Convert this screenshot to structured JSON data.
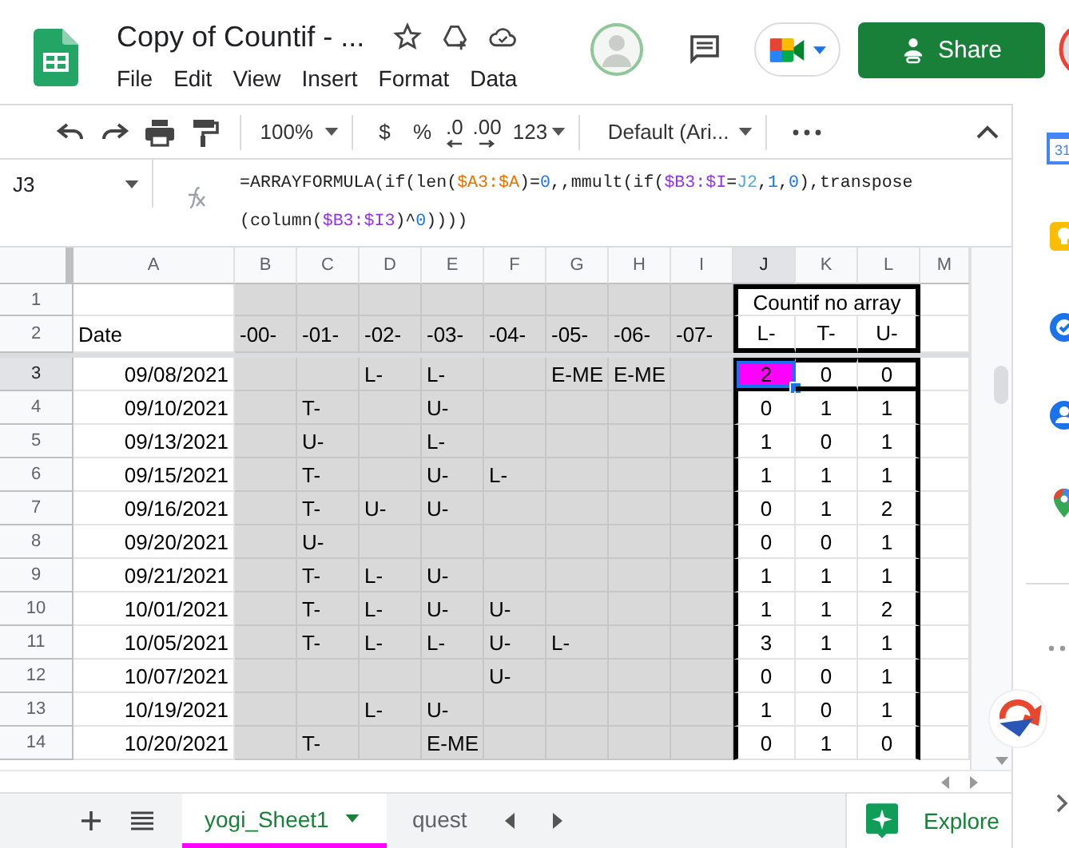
{
  "document": {
    "title": "Copy of Countif - ...",
    "menus": [
      "File",
      "Edit",
      "View",
      "Insert",
      "Format",
      "Data"
    ]
  },
  "header_actions": {
    "share": "Share"
  },
  "toolbar": {
    "zoom": "100%",
    "currency": "$",
    "percent": "%",
    "decrease_decimals": ".0",
    "increase_decimals": ".00",
    "number_format": "123",
    "font": "Default (Ari..."
  },
  "formula_bar": {
    "cell": "J3",
    "lines": [
      [
        {
          "text": "=ARRAYFORMULA(if(len(",
          "kind": "plain"
        },
        {
          "text": "$A3:$A",
          "kind": "ref",
          "color": "#e37400"
        },
        {
          "text": ")=",
          "kind": "plain"
        },
        {
          "text": "0",
          "kind": "number"
        },
        {
          "text": ",,mmult(if(",
          "kind": "plain"
        },
        {
          "text": "$B3:$I",
          "kind": "ref",
          "color": "#9334e6"
        },
        {
          "text": "=",
          "kind": "plain"
        },
        {
          "text": "J2",
          "kind": "ref",
          "color": "#4fa8e0"
        },
        {
          "text": ",",
          "kind": "plain"
        },
        {
          "text": "1",
          "kind": "number"
        },
        {
          "text": ",",
          "kind": "plain"
        },
        {
          "text": "0",
          "kind": "number"
        },
        {
          "text": "),transpose",
          "kind": "plain"
        }
      ],
      [
        {
          "text": "(column(",
          "kind": "plain"
        },
        {
          "text": "$B3:$I3",
          "kind": "ref",
          "color": "#9334e6"
        },
        {
          "text": ")^",
          "kind": "plain"
        },
        {
          "text": "0",
          "kind": "number"
        },
        {
          "text": "))))",
          "kind": "plain"
        }
      ]
    ]
  },
  "sheet": {
    "columns": [
      {
        "letter": "A",
        "shaded": false,
        "boxed": false,
        "selected": false
      },
      {
        "letter": "B",
        "shaded": true,
        "boxed": false,
        "selected": false
      },
      {
        "letter": "C",
        "shaded": true,
        "boxed": false,
        "selected": false
      },
      {
        "letter": "D",
        "shaded": true,
        "boxed": false,
        "selected": false
      },
      {
        "letter": "E",
        "shaded": true,
        "boxed": false,
        "selected": false
      },
      {
        "letter": "F",
        "shaded": true,
        "boxed": false,
        "selected": false
      },
      {
        "letter": "G",
        "shaded": true,
        "boxed": false,
        "selected": false
      },
      {
        "letter": "H",
        "shaded": true,
        "boxed": false,
        "selected": false
      },
      {
        "letter": "I",
        "shaded": true,
        "boxed": false,
        "selected": false
      },
      {
        "letter": "J",
        "shaded": false,
        "boxed": true,
        "selected": true
      },
      {
        "letter": "K",
        "shaded": false,
        "boxed": true,
        "selected": false
      },
      {
        "letter": "L",
        "shaded": false,
        "boxed": true,
        "selected": false
      },
      {
        "letter": "M",
        "shaded": false,
        "boxed": false,
        "selected": false
      }
    ],
    "rows": [
      {
        "number": "1",
        "kind": "caption",
        "selected": false,
        "rule_above": true,
        "rule_below": false,
        "cells": {
          "J": "Countif no array"
        }
      },
      {
        "number": "2",
        "kind": "header",
        "selected": false,
        "rule_above": false,
        "rule_below": true,
        "cells": {
          "A": "Date",
          "B": "-00-",
          "C": "-01-",
          "D": "-02-",
          "E": "-03-",
          "F": "-04-",
          "G": "-05-",
          "H": "-06-",
          "I": "-07-",
          "J": "L-",
          "K": "T-",
          "L": "U-"
        }
      },
      {
        "number": "3",
        "kind": "data",
        "selected": true,
        "rule_above": true,
        "rule_below": true,
        "cells": {
          "A": "09/08/2021",
          "D": "L-",
          "E": "L-",
          "G": "E-ME",
          "H": "E-ME",
          "J": {
            "text": "2",
            "color": "#ff00ff"
          },
          "K": "0",
          "L": "0"
        }
      },
      {
        "number": "4",
        "kind": "data",
        "selected": false,
        "rule_above": false,
        "rule_below": false,
        "cells": {
          "A": "09/10/2021",
          "C": "T-",
          "E": "U-",
          "J": "0",
          "K": "1",
          "L": "1"
        }
      },
      {
        "number": "5",
        "kind": "data",
        "selected": false,
        "rule_above": false,
        "rule_below": false,
        "cells": {
          "A": "09/13/2021",
          "C": "U-",
          "E": "L-",
          "J": "1",
          "K": "0",
          "L": "1"
        }
      },
      {
        "number": "6",
        "kind": "data",
        "selected": false,
        "rule_above": false,
        "rule_below": false,
        "cells": {
          "A": "09/15/2021",
          "C": "T-",
          "E": "U-",
          "F": "L-",
          "J": "1",
          "K": "1",
          "L": "1"
        }
      },
      {
        "number": "7",
        "kind": "data",
        "selected": false,
        "rule_above": false,
        "rule_below": false,
        "cells": {
          "A": "09/16/2021",
          "C": "T-",
          "D": "U-",
          "E": "U-",
          "J": "0",
          "K": "1",
          "L": "2"
        }
      },
      {
        "number": "8",
        "kind": "data",
        "selected": false,
        "rule_above": false,
        "rule_below": false,
        "cells": {
          "A": "09/20/2021",
          "C": "U-",
          "J": "0",
          "K": "0",
          "L": "1"
        }
      },
      {
        "number": "9",
        "kind": "data",
        "selected": false,
        "rule_above": false,
        "rule_below": false,
        "cells": {
          "A": "09/21/2021",
          "C": "T-",
          "D": "L-",
          "E": "U-",
          "J": "1",
          "K": "1",
          "L": "1"
        }
      },
      {
        "number": "10",
        "kind": "data",
        "selected": false,
        "rule_above": false,
        "rule_below": false,
        "cells": {
          "A": "10/01/2021",
          "C": "T-",
          "D": "L-",
          "E": "U-",
          "F": "U-",
          "J": "1",
          "K": "1",
          "L": "2"
        }
      },
      {
        "number": "11",
        "kind": "data",
        "selected": false,
        "rule_above": false,
        "rule_below": false,
        "cells": {
          "A": "10/05/2021",
          "C": "T-",
          "D": "L-",
          "E": "L-",
          "F": "U-",
          "G": "L-",
          "J": "3",
          "K": "1",
          "L": "1"
        }
      },
      {
        "number": "12",
        "kind": "data",
        "selected": false,
        "rule_above": false,
        "rule_below": false,
        "cells": {
          "A": "10/07/2021",
          "F": "U-",
          "J": "0",
          "K": "0",
          "L": "1"
        }
      },
      {
        "number": "13",
        "kind": "data",
        "selected": false,
        "rule_above": false,
        "rule_below": false,
        "cells": {
          "A": "10/19/2021",
          "D": "L-",
          "E": "U-",
          "J": "1",
          "K": "0",
          "L": "1"
        }
      },
      {
        "number": "14",
        "kind": "data",
        "selected": false,
        "rule_above": false,
        "rule_below": false,
        "cells": {
          "A": "10/20/2021",
          "C": "T-",
          "E": "E-ME",
          "J": "0",
          "K": "1",
          "L": "0"
        }
      }
    ]
  },
  "sheet_tabs": [
    {
      "label": "yogi_Sheet1",
      "selected": true,
      "color": "#ff00ff"
    },
    {
      "label": "quest",
      "selected": false
    }
  ],
  "explore": "Explore",
  "side_panel": {
    "calendar_day": "31"
  }
}
